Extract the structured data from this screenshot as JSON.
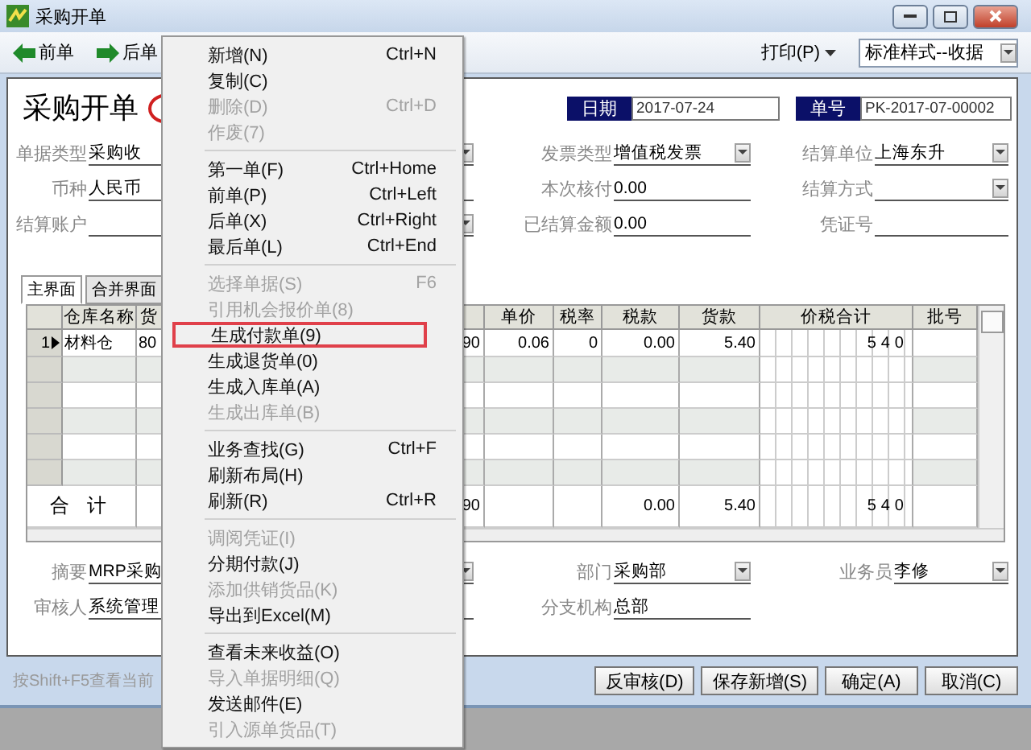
{
  "window": {
    "title": "采购开单"
  },
  "toolbar": {
    "buttons": [
      {
        "label": "前单",
        "kind": "prev"
      },
      {
        "label": "后单",
        "kind": "next"
      }
    ],
    "print": "打印(P)",
    "style_select": "标准样式--收据"
  },
  "form": {
    "title": "采购开单",
    "date": {
      "label": "日期",
      "value": "2017-07-24"
    },
    "number": {
      "label": "单号",
      "value": "PK-2017-07-00002"
    },
    "fields": [
      [
        {
          "label": "单据类型",
          "value": "采购收",
          "dropdown": true
        },
        {
          "label": "发票类型",
          "value": "增值税发票",
          "dropdown": true
        },
        {
          "label": "结算单位",
          "value": "上海东升",
          "dropdown": true
        }
      ],
      [
        {
          "label": "币种",
          "value": "人民币",
          "dropdown": false
        },
        {
          "label": "本次核付",
          "value": "0.00",
          "dropdown": false
        },
        {
          "label": "结算方式",
          "dropdown": true
        }
      ],
      [
        {
          "label": "结算账户",
          "dropdown": true
        },
        {
          "label": "已结算金额",
          "value": "0.00",
          "dropdown": false
        },
        {
          "label": "凭证号",
          "dropdown": false
        }
      ]
    ]
  },
  "tabs": [
    {
      "label": "主界面",
      "selected": true
    },
    {
      "label": "合并界面",
      "selected": false
    }
  ],
  "table": {
    "columns": [
      {
        "label": "仓库名称",
        "kind": "text"
      },
      {
        "label": "货",
        "kind": "text"
      },
      {
        "kind": "number"
      },
      {
        "label": "单价",
        "kind": "number"
      },
      {
        "label": "税率",
        "kind": "number"
      },
      {
        "label": "税款",
        "kind": "number"
      },
      {
        "label": "货款",
        "kind": "number"
      },
      {
        "label": "价税合计",
        "kind": "amount_grid"
      },
      {
        "label": "批号",
        "kind": "text"
      }
    ],
    "rows": [
      {
        "number": "1",
        "current": true,
        "cells": [
          "材料仓",
          "80",
          "90",
          "0.06",
          "0",
          "0.00",
          "5.40",
          "540",
          null
        ]
      }
    ],
    "total": {
      "label": "合 计",
      "cells": [
        null,
        "90",
        null,
        null,
        "0.00",
        "5.40",
        "540",
        null
      ]
    }
  },
  "footer_fields": [
    [
      {
        "label": "摘要",
        "value": "MRP采购",
        "dropdown": true
      },
      {
        "label": "部门",
        "value": "采购部",
        "dropdown": true
      },
      {
        "label": "业务员",
        "value": "李修",
        "dropdown": true
      }
    ],
    [
      {
        "label": "审核人",
        "value": "系统管理",
        "dropdown": false
      },
      {
        "label": "分支机构",
        "value": "总部",
        "dropdown": false
      }
    ]
  ],
  "status_bar": "按Shift+F5查看当前",
  "buttons": [
    "反审核(D)",
    "保存新增(S)",
    "确定(A)",
    "取消(C)"
  ],
  "menu": {
    "items": [
      {
        "kind": "item",
        "label": "新增(N)",
        "shortcut": "Ctrl+N",
        "disabled": false
      },
      {
        "kind": "item",
        "label": "复制(C)",
        "disabled": false
      },
      {
        "kind": "item",
        "label": "删除(D)",
        "shortcut": "Ctrl+D",
        "disabled": true
      },
      {
        "kind": "item",
        "label": "作废(7)",
        "disabled": true
      },
      {
        "kind": "separator"
      },
      {
        "kind": "item",
        "label": "第一单(F)",
        "shortcut": "Ctrl+Home",
        "disabled": false
      },
      {
        "kind": "item",
        "label": "前单(P)",
        "shortcut": "Ctrl+Left",
        "disabled": false
      },
      {
        "kind": "item",
        "label": "后单(X)",
        "shortcut": "Ctrl+Right",
        "disabled": false
      },
      {
        "kind": "item",
        "label": "最后单(L)",
        "shortcut": "Ctrl+End",
        "disabled": false
      },
      {
        "kind": "separator"
      },
      {
        "kind": "item",
        "label": "选择单据(S)",
        "shortcut": "F6",
        "disabled": true
      },
      {
        "kind": "item",
        "label": "引用机会报价单(8)",
        "disabled": true
      },
      {
        "kind": "item",
        "label": "生成付款单(9)",
        "disabled": false,
        "highlighted": true
      },
      {
        "kind": "item",
        "label": "生成退货单(0)",
        "disabled": false
      },
      {
        "kind": "item",
        "label": "生成入库单(A)",
        "disabled": false
      },
      {
        "kind": "item",
        "label": "生成出库单(B)",
        "disabled": true
      },
      {
        "kind": "separator"
      },
      {
        "kind": "item",
        "label": "业务查找(G)",
        "shortcut": "Ctrl+F",
        "disabled": false
      },
      {
        "kind": "item",
        "label": "刷新布局(H)",
        "disabled": false
      },
      {
        "kind": "item",
        "label": "刷新(R)",
        "shortcut": "Ctrl+R",
        "disabled": false
      },
      {
        "kind": "separator"
      },
      {
        "kind": "item",
        "label": "调阅凭证(I)",
        "disabled": true
      },
      {
        "kind": "item",
        "label": "分期付款(J)",
        "disabled": false
      },
      {
        "kind": "item",
        "label": "添加供销货品(K)",
        "disabled": true
      },
      {
        "kind": "item",
        "label": "导出到Excel(M)",
        "disabled": false
      },
      {
        "kind": "separator"
      },
      {
        "kind": "item",
        "label": "查看未来收益(O)",
        "disabled": false
      },
      {
        "kind": "item",
        "label": "导入单据明细(Q)",
        "disabled": true
      },
      {
        "kind": "item",
        "label": "发送邮件(E)",
        "disabled": false
      },
      {
        "kind": "item",
        "label": "引入源单货品(T)",
        "disabled": true
      }
    ]
  }
}
